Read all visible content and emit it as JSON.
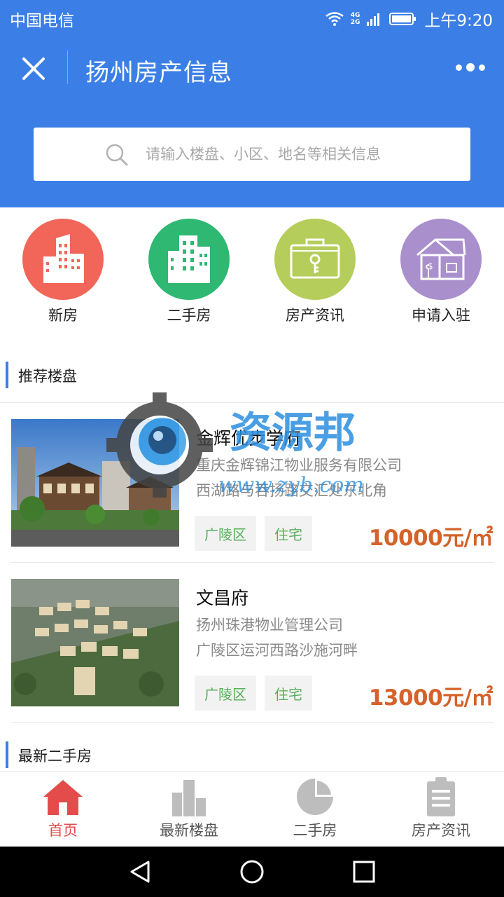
{
  "status_bar": {
    "carrier": "中国电信",
    "network": "4G\n2G",
    "time": "上午9:20"
  },
  "header": {
    "title": "扬州房产信息"
  },
  "search": {
    "placeholder": "请输入楼盘、小区、地名等相关信息"
  },
  "categories": [
    {
      "label": "新房",
      "color": "#f2665a",
      "icon": "buildings-icon"
    },
    {
      "label": "二手房",
      "color": "#2eb872",
      "icon": "tower-icon"
    },
    {
      "label": "房产资讯",
      "color": "#b5cd5a",
      "icon": "key-case-icon"
    },
    {
      "label": "申请入驻",
      "color": "#a98fcc",
      "icon": "house-icon"
    }
  ],
  "section_recommended": {
    "title": "推荐楼盘"
  },
  "listings": [
    {
      "name": "金辉优步学府",
      "company": "重庆金辉锦江物业服务有限公司",
      "address": "西湖路与吞扬路交汇处东北角",
      "tags": [
        "广陵区",
        "住宅"
      ],
      "price": "10000元/㎡"
    },
    {
      "name": "文昌府",
      "company": "扬州珠港物业管理公司",
      "address": "广陵区运河西路沙施河畔",
      "tags": [
        "广陵区",
        "住宅"
      ],
      "price": "13000元/㎡"
    }
  ],
  "section_latest": {
    "title": "最新二手房"
  },
  "watermark": {
    "text": "资源邦",
    "url": "www.zyb.com"
  },
  "bottom_nav": [
    {
      "label": "首页",
      "icon": "home-icon",
      "active": true
    },
    {
      "label": "最新楼盘",
      "icon": "bar-chart-icon",
      "active": false
    },
    {
      "label": "二手房",
      "icon": "pie-chart-icon",
      "active": false
    },
    {
      "label": "房产资讯",
      "icon": "clipboard-icon",
      "active": false
    }
  ],
  "colors": {
    "primary": "#3b7fe6",
    "price": "#d5622a",
    "tag_text": "#56b05a",
    "nav_active": "#e44b4b"
  }
}
